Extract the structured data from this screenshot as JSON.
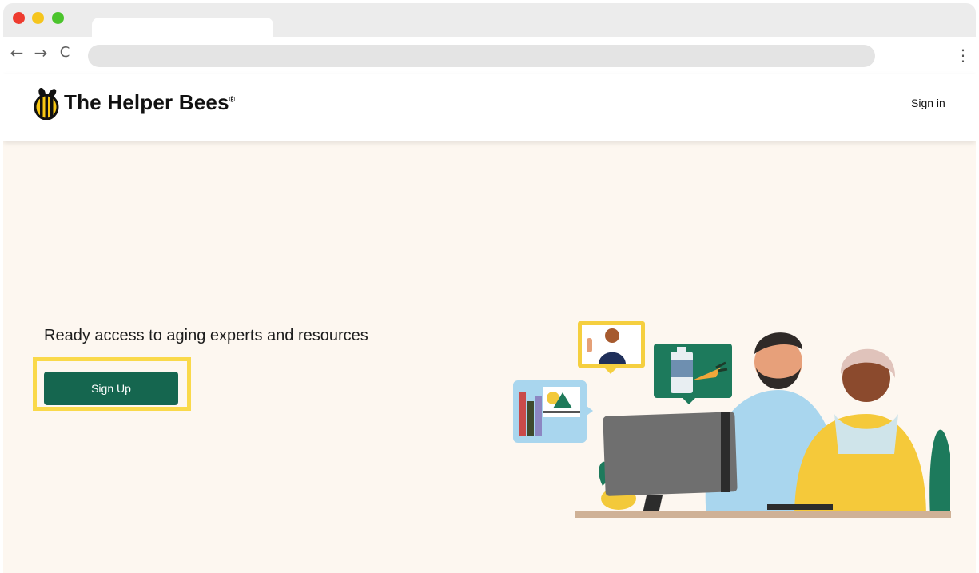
{
  "browser": {
    "back_icon": "←",
    "forward_icon": "→",
    "reload_icon": "C",
    "menu_icon": "⋮",
    "traffic_colors": [
      "#ee3b2f",
      "#f5c51d",
      "#4bc42c"
    ]
  },
  "header": {
    "brand": "The Helper Bees",
    "registered_mark": "®",
    "sign_in_label": "Sign in"
  },
  "hero": {
    "headline": "Ready access to aging experts and resources",
    "cta_label": "Sign Up",
    "cta_color": "#15664f",
    "highlight_color": "#fad94a"
  },
  "colors": {
    "hero_background": "#fdf7f0"
  }
}
